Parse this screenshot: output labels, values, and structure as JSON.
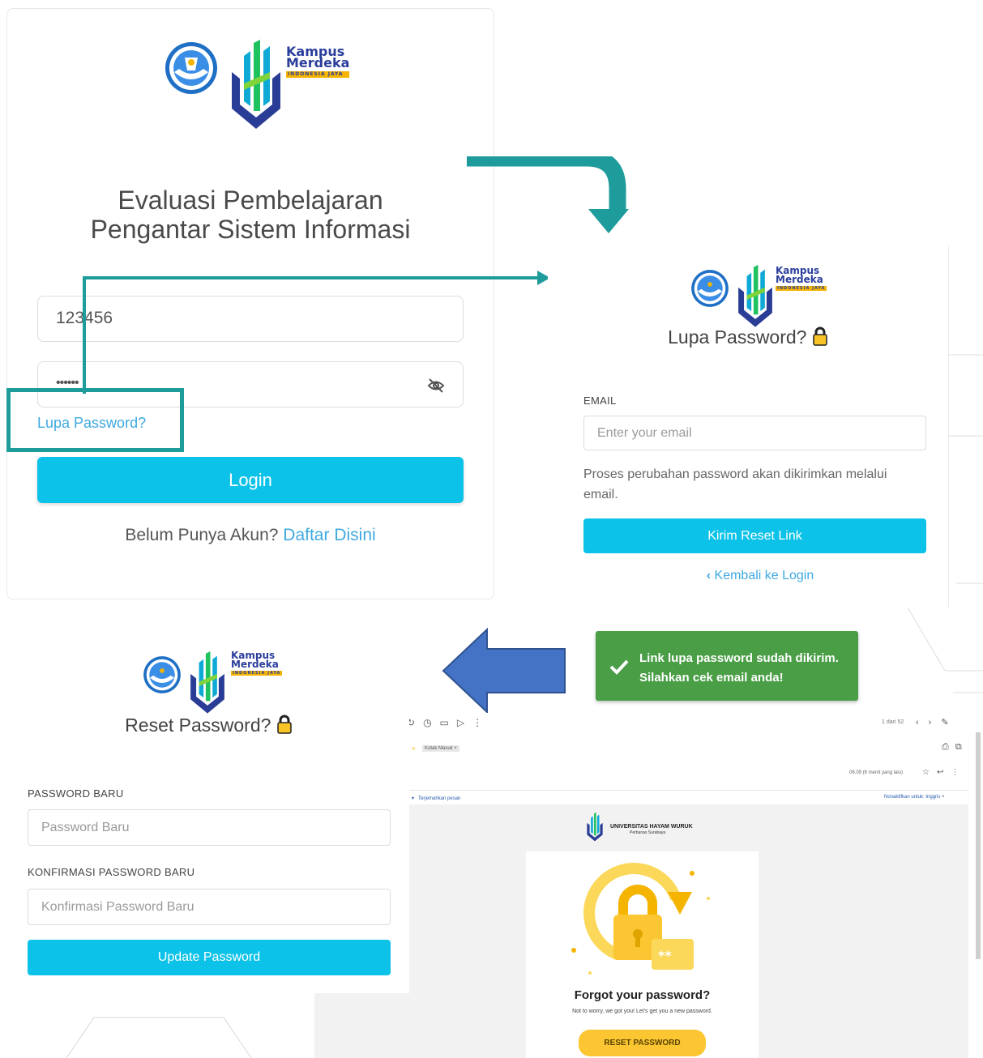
{
  "login": {
    "title_line1": "Evaluasi Pembelajaran",
    "title_line2": "Pengantar Sistem Informasi",
    "username_value": "123456",
    "password_value": "••••••",
    "forgot_link": "Lupa Password?",
    "login_button": "Login",
    "register_prompt": "Belum Punya Akun?",
    "register_link": "Daftar Disini"
  },
  "logo": {
    "line1": "Kampus",
    "line2": "Merdeka",
    "tagline": "INDONESIA JAYA"
  },
  "forgot": {
    "title": "Lupa Password?",
    "email_label": "EMAIL",
    "email_placeholder": "Enter your email",
    "info_text": "Proses perubahan password akan dikirimkan melalui email.",
    "send_button": "Kirim Reset Link",
    "back_link": "Kembali ke Login"
  },
  "toast": {
    "line1": "Link lupa password sudah dikirim.",
    "line2": "Silahkan cek email anda!"
  },
  "reset": {
    "title": "Reset Password?",
    "new_label": "PASSWORD BARU",
    "new_placeholder": "Password Baru",
    "confirm_label": "KONFIRMASI PASSWORD BARU",
    "confirm_placeholder": "Konfirmasi Password Baru",
    "update_button": "Update Password"
  },
  "email": {
    "pager": "1 dari 52",
    "inbox_chip": "Kotak Masuk ×",
    "time": "06.09 (6 menit yang lalu)",
    "translate": "Terjemahkan pesan",
    "disable_translate": "Nonaktifkan untuk: Inggris",
    "univ_name": "UNIVERSITAS HAYAM WURUK",
    "univ_sub": "Perbanas Surabaya",
    "heading": "Forgot your password?",
    "body": "Not to worry, we got you! Let's get you a new password.",
    "button": "RESET PASSWORD"
  },
  "colors": {
    "primary": "#0cc2e8",
    "teal_arrow": "#1e9b9b",
    "blue_arrow": "#4472c4",
    "toast_green": "#4a9e46",
    "link_blue": "#3fa9e0",
    "email_yellow": "#fbc631"
  }
}
